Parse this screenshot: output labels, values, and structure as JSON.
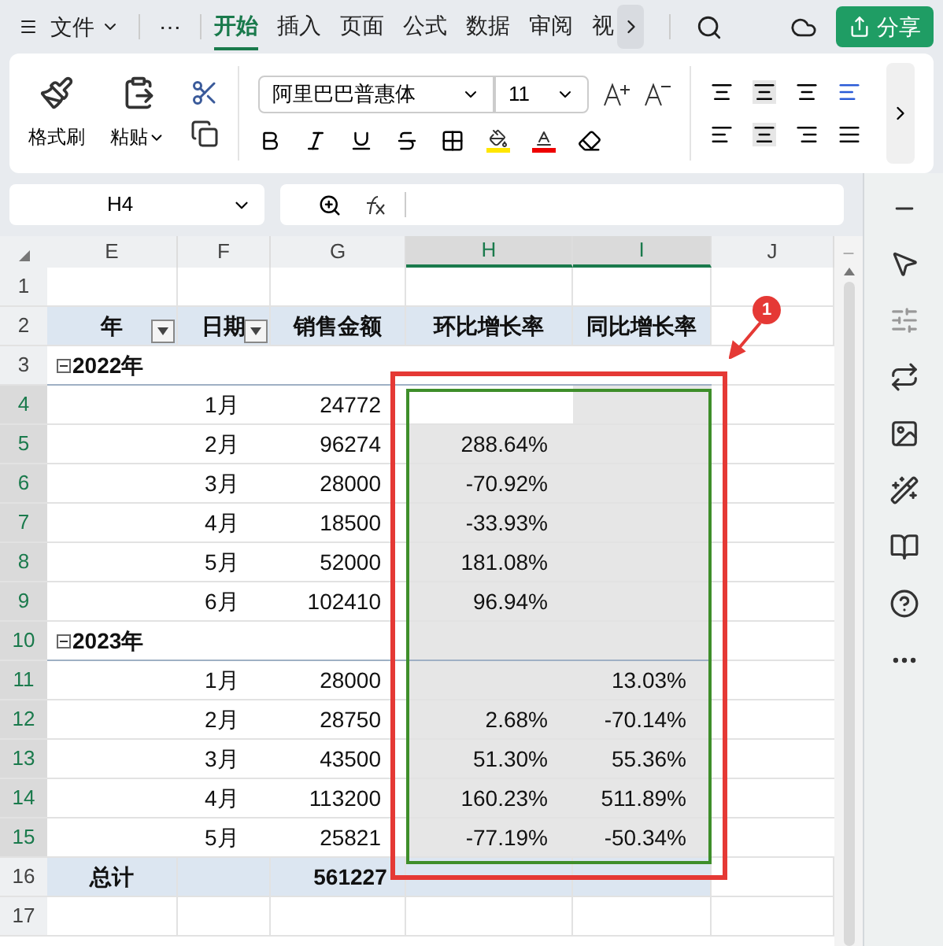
{
  "menu": {
    "file": "文件",
    "more": "⋯",
    "tabs": [
      {
        "label": "开始",
        "selected": true
      },
      {
        "label": "插入",
        "selected": false
      },
      {
        "label": "页面",
        "selected": false
      },
      {
        "label": "公式",
        "selected": false
      },
      {
        "label": "数据",
        "selected": false
      },
      {
        "label": "审阅",
        "selected": false
      },
      {
        "label": "视",
        "selected": false
      }
    ],
    "share": "分享"
  },
  "ribbon": {
    "format_painter": "格式刷",
    "paste": "粘贴",
    "font": "阿里巴巴普惠体",
    "size": "11"
  },
  "formula_bar": {
    "cell": "H4"
  },
  "sheet": {
    "columns": [
      {
        "label": "E",
        "selected": false
      },
      {
        "label": "F",
        "selected": false
      },
      {
        "label": "G",
        "selected": false
      },
      {
        "label": "H",
        "selected": true
      },
      {
        "label": "I",
        "selected": true
      },
      {
        "label": "J",
        "selected": false
      }
    ],
    "rows": [
      {
        "number": "1",
        "kind": "blank",
        "selected": false,
        "active": false,
        "cells": [
          "",
          "",
          "",
          "",
          "",
          ""
        ]
      },
      {
        "number": "2",
        "kind": "header",
        "selected": false,
        "active": false,
        "cells": [
          "年",
          "日期",
          "销售金额",
          "环比增长率",
          "同比增长率",
          ""
        ]
      },
      {
        "number": "3",
        "kind": "group",
        "selected": false,
        "active": false,
        "cells": [
          "2022年",
          "",
          "",
          "",
          "",
          ""
        ]
      },
      {
        "number": "4",
        "kind": "data",
        "selected": true,
        "active": true,
        "cells": [
          "",
          "1月",
          "24772",
          "",
          "",
          ""
        ]
      },
      {
        "number": "5",
        "kind": "data",
        "selected": true,
        "active": false,
        "cells": [
          "",
          "2月",
          "96274",
          "288.64%",
          "",
          ""
        ]
      },
      {
        "number": "6",
        "kind": "data",
        "selected": true,
        "active": false,
        "cells": [
          "",
          "3月",
          "28000",
          "-70.92%",
          "",
          ""
        ]
      },
      {
        "number": "7",
        "kind": "data",
        "selected": true,
        "active": false,
        "cells": [
          "",
          "4月",
          "18500",
          "-33.93%",
          "",
          ""
        ]
      },
      {
        "number": "8",
        "kind": "data",
        "selected": true,
        "active": false,
        "cells": [
          "",
          "5月",
          "52000",
          "181.08%",
          "",
          ""
        ]
      },
      {
        "number": "9",
        "kind": "data",
        "selected": true,
        "active": false,
        "cells": [
          "",
          "6月",
          "102410",
          "96.94%",
          "",
          ""
        ]
      },
      {
        "number": "10",
        "kind": "group",
        "selected": true,
        "active": false,
        "cells": [
          "2023年",
          "",
          "",
          "",
          "",
          ""
        ]
      },
      {
        "number": "11",
        "kind": "data",
        "selected": true,
        "active": false,
        "cells": [
          "",
          "1月",
          "28000",
          "",
          "13.03%",
          ""
        ]
      },
      {
        "number": "12",
        "kind": "data",
        "selected": true,
        "active": false,
        "cells": [
          "",
          "2月",
          "28750",
          "2.68%",
          "-70.14%",
          ""
        ]
      },
      {
        "number": "13",
        "kind": "data",
        "selected": true,
        "active": false,
        "cells": [
          "",
          "3月",
          "43500",
          "51.30%",
          "55.36%",
          ""
        ]
      },
      {
        "number": "14",
        "kind": "data",
        "selected": true,
        "active": false,
        "cells": [
          "",
          "4月",
          "113200",
          "160.23%",
          "511.89%",
          ""
        ]
      },
      {
        "number": "15",
        "kind": "data",
        "selected": true,
        "active": false,
        "cells": [
          "",
          "5月",
          "25821",
          "-77.19%",
          "-50.34%",
          ""
        ]
      },
      {
        "number": "16",
        "kind": "total",
        "selected": false,
        "active": false,
        "cells": [
          "总计",
          "",
          "561227",
          "",
          "",
          ""
        ]
      },
      {
        "number": "17",
        "kind": "blank",
        "selected": false,
        "active": false,
        "cells": [
          "",
          "",
          "",
          "",
          "",
          ""
        ]
      }
    ]
  },
  "callout": {
    "number": "1"
  }
}
